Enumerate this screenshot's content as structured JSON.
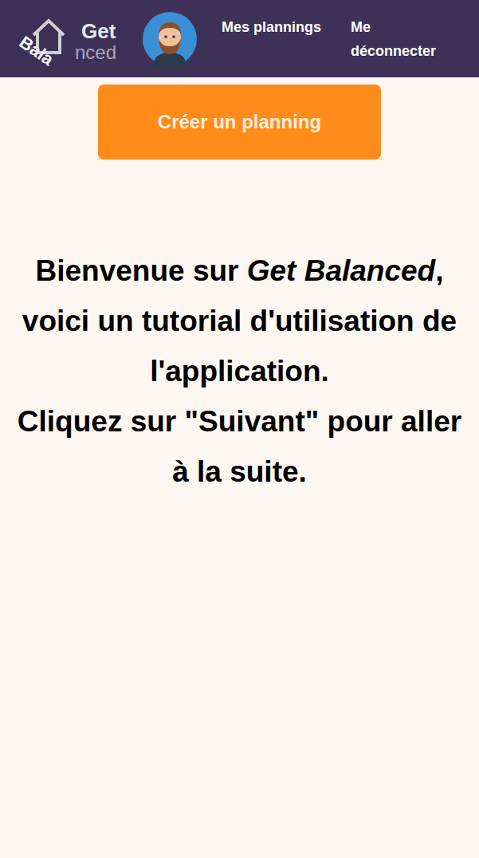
{
  "header": {
    "logo": {
      "top": "Get",
      "slanted": "Bala",
      "rest": "nced"
    },
    "nav": [
      "Mes plannings",
      "Me déconnecter"
    ]
  },
  "create_button": "Créer un planning",
  "intro": {
    "paragraphs": [
      [
        {
          "text": "Bienvenue sur ",
          "italic": false
        },
        {
          "text": "Get Balanced",
          "italic": true
        },
        {
          "text": ", voici un tutorial d'utilisation de l'application.",
          "italic": false
        }
      ],
      [
        {
          "text": "Cliquez sur \"Suivant\" pour aller à la suite.",
          "italic": false
        }
      ]
    ]
  }
}
